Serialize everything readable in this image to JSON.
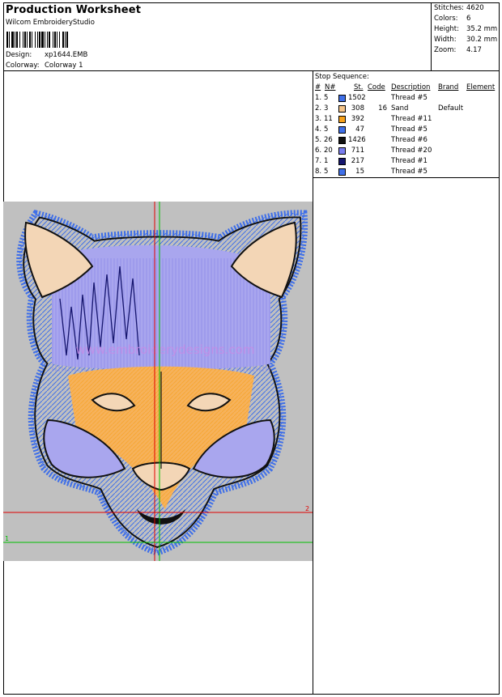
{
  "header": {
    "title": "Production Worksheet",
    "software": "Wilcom  EmbroideryStudio",
    "design_label": "Design:",
    "design_value": "xp1644.EMB",
    "colorway_label": "Colorway:",
    "colorway_value": "Colorway 1"
  },
  "stats": {
    "stitches_label": "Stitches:",
    "stitches": "4620",
    "colors_label": "Colors:",
    "colors": "6",
    "height_label": "Height:",
    "height": "35.2 mm",
    "width_label": "Width:",
    "width": "30.2 mm",
    "zoom_label": "Zoom:",
    "zoom": "4.17"
  },
  "stop_sequence": {
    "title": "Stop Sequence:",
    "headers": [
      "#",
      "N#",
      "St.",
      "Code",
      "Description",
      "Brand",
      "Element"
    ],
    "rows": [
      {
        "num": "1.",
        "n": "5",
        "color": "#3f6fe8",
        "st": "1502",
        "code": "",
        "desc": "Thread #5",
        "brand": ""
      },
      {
        "num": "2.",
        "n": "3",
        "color": "#f5c58a",
        "st": "308",
        "code": "16",
        "desc": "Sand",
        "brand": "Default"
      },
      {
        "num": "3.",
        "n": "11",
        "color": "#f7a11a",
        "st": "392",
        "code": "",
        "desc": "Thread #11",
        "brand": ""
      },
      {
        "num": "4.",
        "n": "5",
        "color": "#3f6fe8",
        "st": "47",
        "code": "",
        "desc": "Thread #5",
        "brand": ""
      },
      {
        "num": "5.",
        "n": "26",
        "color": "#111111",
        "st": "1426",
        "code": "",
        "desc": "Thread #6",
        "brand": ""
      },
      {
        "num": "6.",
        "n": "20",
        "color": "#7a7ef0",
        "st": "711",
        "code": "",
        "desc": "Thread #20",
        "brand": ""
      },
      {
        "num": "7.",
        "n": "1",
        "color": "#16166e",
        "st": "217",
        "code": "",
        "desc": "Thread #1",
        "brand": ""
      },
      {
        "num": "8.",
        "n": "5",
        "color": "#3f6fe8",
        "st": "15",
        "code": "",
        "desc": "Thread #5",
        "brand": ""
      }
    ]
  },
  "design_view": {
    "marker_1": "1",
    "marker_2": "2",
    "watermark": "www.embroiderydesigns.com",
    "colors": {
      "background": "#c0c0c0",
      "outline": "#3f6fe8",
      "fill_blue": "#a9a6ee",
      "fill_orange": "#f6b25c",
      "black": "#111111",
      "navy": "#16166e",
      "red_guide": "#e00000",
      "green_guide": "#00c000"
    }
  }
}
